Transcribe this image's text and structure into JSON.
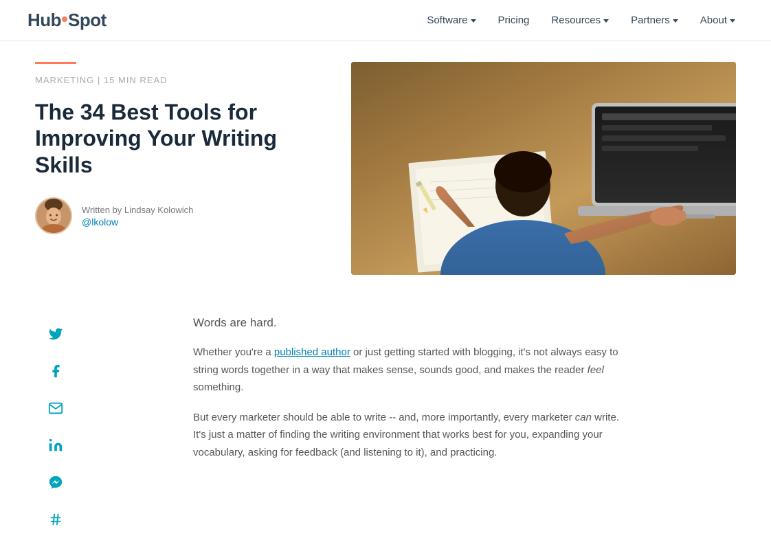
{
  "logo": {
    "hub": "Hub",
    "spot": "Sp",
    "t": "t",
    "full": "HubSpot"
  },
  "nav": {
    "links": [
      {
        "label": "Software",
        "has_dropdown": true,
        "id": "software"
      },
      {
        "label": "Pricing",
        "has_dropdown": false,
        "id": "pricing"
      },
      {
        "label": "Resources",
        "has_dropdown": true,
        "id": "resources"
      },
      {
        "label": "Partners",
        "has_dropdown": true,
        "id": "partners"
      },
      {
        "label": "About",
        "has_dropdown": true,
        "id": "about"
      }
    ]
  },
  "article": {
    "category": "MARKETING",
    "read_time": "15 MIN READ",
    "title": "The 34 Best Tools for Improving Your Writing Skills",
    "author": {
      "written_by": "Written by Lindsay Kolowich",
      "handle": "@lkolow"
    }
  },
  "body": {
    "intro": "Words are hard.",
    "para1": "Whether you're a published author or just getting started with blogging, it's not always easy to string words together in a way that makes sense, sounds good, and makes the reader ",
    "para1_em": "feel",
    "para1_end": " something.",
    "para2_start": "But every marketer should be able to write -- and, more importantly, every marketer ",
    "para2_em": "can",
    "para2_end": " write. It's just a matter of finding the writing environment that works best for you, expanding your vocabulary, asking for feedback (and listening to it), and practicing."
  },
  "social": {
    "icons": [
      {
        "name": "twitter",
        "symbol": "twitter-icon"
      },
      {
        "name": "facebook",
        "symbol": "facebook-icon"
      },
      {
        "name": "email",
        "symbol": "email-icon"
      },
      {
        "name": "linkedin",
        "symbol": "linkedin-icon"
      },
      {
        "name": "messenger",
        "symbol": "messenger-icon"
      },
      {
        "name": "slack",
        "symbol": "slack-icon"
      }
    ]
  },
  "colors": {
    "accent": "#ff7a59",
    "nav_text": "#33475b",
    "link": "#0082b4",
    "social": "#00a4bd"
  }
}
